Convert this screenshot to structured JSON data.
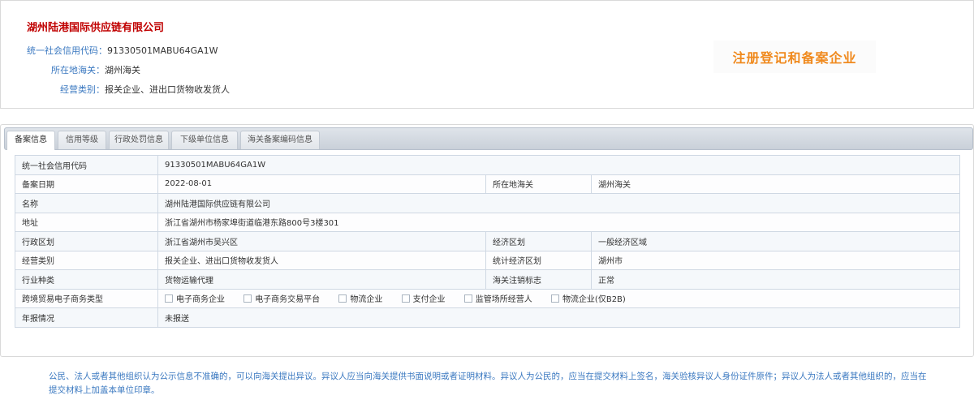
{
  "header": {
    "company_name": "湖州陆港国际供应链有限公司",
    "credit_code_label": "统一社会信用代码：",
    "credit_code_value": "91330501MABU64GA1W",
    "customs_label": "所在地海关：",
    "customs_value": "湖州海关",
    "category_label": "经营类别：",
    "category_value": "报关企业、进出口货物收发货人",
    "badge": "注册登记和备案企业"
  },
  "tabs": [
    {
      "label": "备案信息",
      "active": true
    },
    {
      "label": "信用等级"
    },
    {
      "label": "行政处罚信息"
    },
    {
      "label": "下级单位信息"
    },
    {
      "label": "海关备案编码信息"
    }
  ],
  "table": {
    "credit_code": {
      "label": "统一社会信用代码",
      "value": "91330501MABU64GA1W"
    },
    "record_date": {
      "label": "备案日期",
      "value": "2022-08-01"
    },
    "customs": {
      "label": "所在地海关",
      "value": "湖州海关"
    },
    "name": {
      "label": "名称",
      "value": "湖州陆港国际供应链有限公司"
    },
    "address": {
      "label": "地址",
      "value": "浙江省湖州市杨家埠街道临港东路800号3楼301"
    },
    "admin_region": {
      "label": "行政区划",
      "value": "浙江省湖州市吴兴区"
    },
    "econ_region": {
      "label": "经济区划",
      "value": "一般经济区域"
    },
    "business_category": {
      "label": "经营类别",
      "value": "报关企业、进出口货物收发货人"
    },
    "stat_region": {
      "label": "统计经济区划",
      "value": "湖州市"
    },
    "industry": {
      "label": "行业种类",
      "value": "货物运输代理"
    },
    "cancel_flag": {
      "label": "海关注销标志",
      "value": "正常"
    },
    "ecommerce": {
      "label": "跨境贸易电子商务类型",
      "options": [
        "电子商务企业",
        "电子商务交易平台",
        "物流企业",
        "支付企业",
        "监管场所经营人",
        "物流企业(仅B2B)"
      ]
    },
    "annual_report": {
      "label": "年报情况",
      "value": "未报送"
    }
  },
  "notice": "公民、法人或者其他组织认为公示信息不准确的，可以向海关提出异议。异议人应当向海关提供书面说明或者证明材料。异议人为公民的，应当在提交材料上签名，海关验核异议人身份证件原件；异议人为法人或者其他组织的，应当在提交材料上加盖本单位印章。",
  "colors": {
    "company": "#c00000",
    "label_blue": "#3a78c0",
    "badge": "#f08a1e"
  }
}
